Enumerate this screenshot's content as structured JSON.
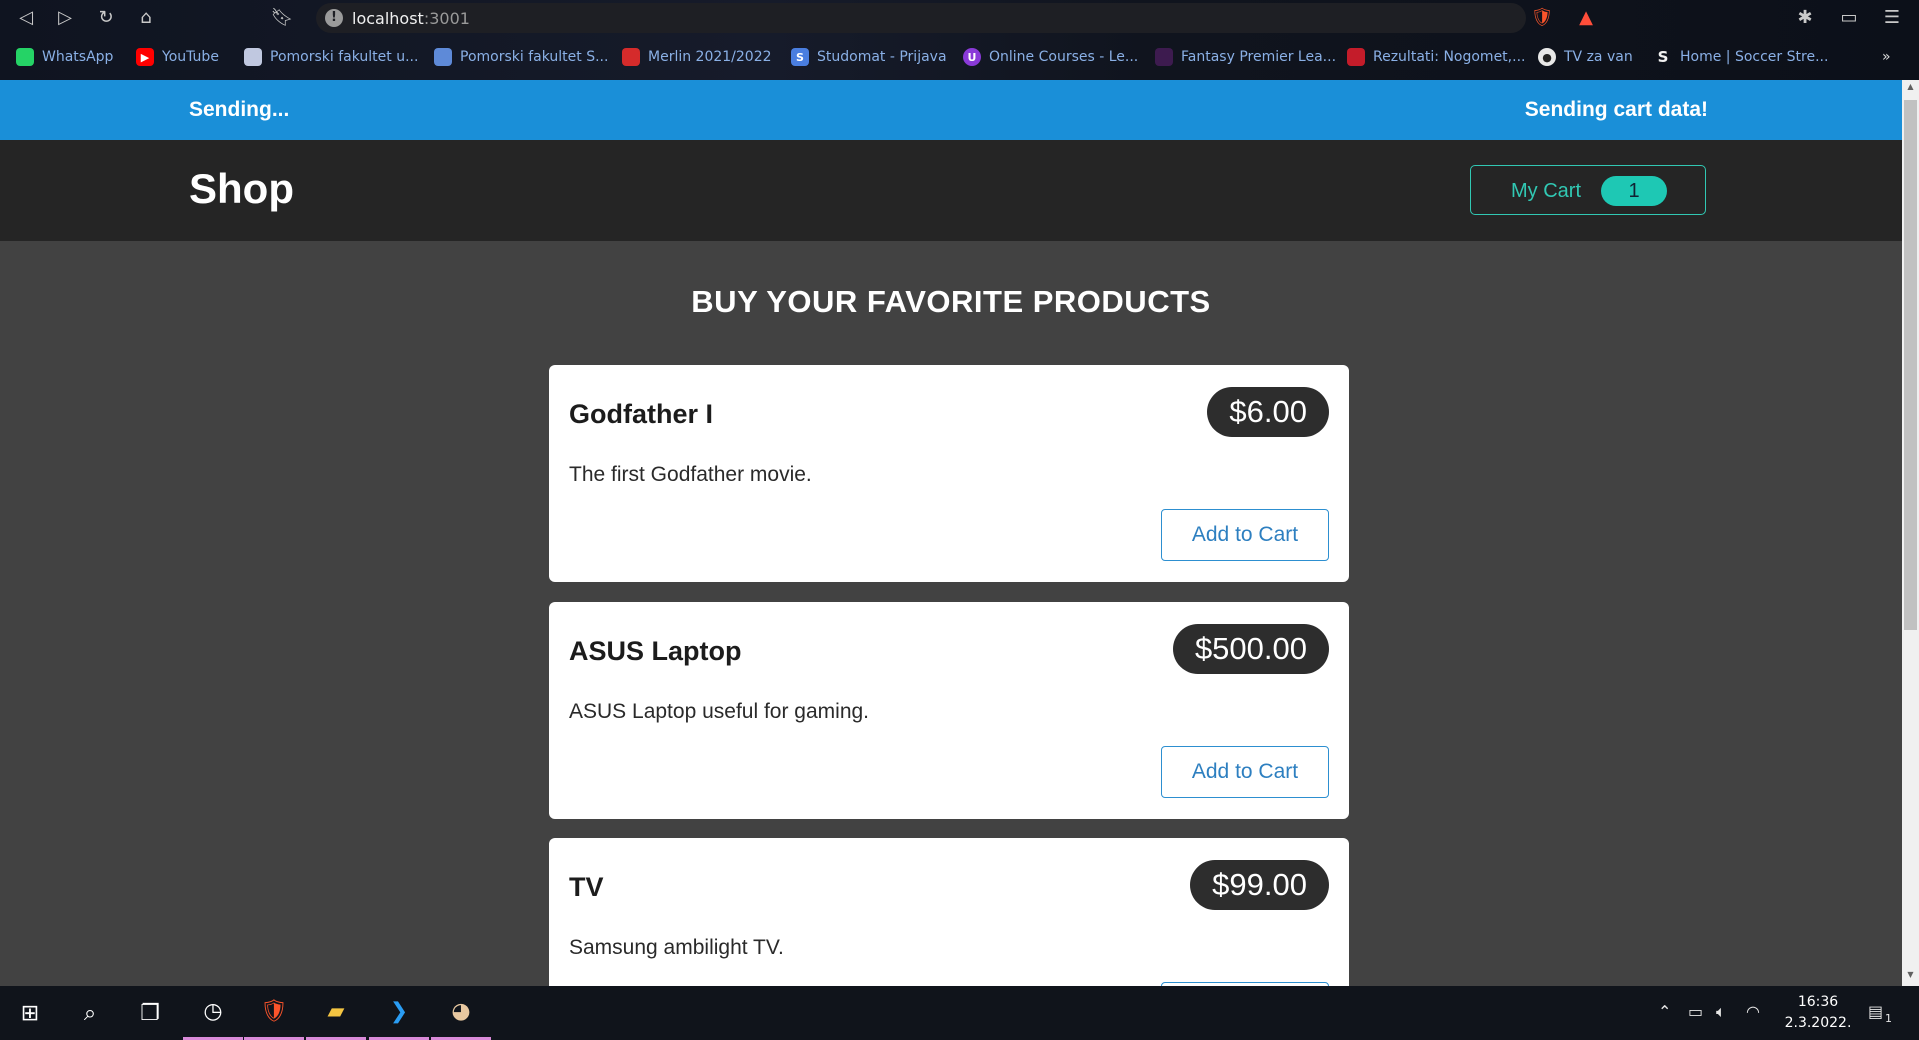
{
  "browser": {
    "url_host": "localhost",
    "url_port": ":3001",
    "bookmarks": [
      {
        "label": "WhatsApp",
        "icon": "whatsapp-icon",
        "color": "#25d366"
      },
      {
        "label": "YouTube",
        "icon": "youtube-icon",
        "color": "#ff0000"
      },
      {
        "label": "Pomorski fakultet u...",
        "icon": "pomorski-icon",
        "color": "#c0c8e0"
      },
      {
        "label": "Pomorski fakultet S...",
        "icon": "pomorski-s-icon",
        "color": "#5e8ad8"
      },
      {
        "label": "Merlin 2021/2022",
        "icon": "merlin-icon",
        "color": "#d52b2b"
      },
      {
        "label": "Studomat - Prijava",
        "icon": "studomat-icon",
        "color": "#4a7ee0"
      },
      {
        "label": "Online Courses - Le...",
        "icon": "udemy-icon",
        "color": "#8a3ad8"
      },
      {
        "label": "Fantasy Premier Lea...",
        "icon": "premier-league-icon",
        "color": "#3d1b4f"
      },
      {
        "label": "Rezultati: Nogomet,...",
        "icon": "rezultati-icon",
        "color": "#c41c2a"
      },
      {
        "label": "TV za van",
        "icon": "tv-globe-icon",
        "color": "#e8e8e8"
      },
      {
        "label": "Home | Soccer Stre...",
        "icon": "soccer-stream-icon",
        "color": "#f2f2f2"
      }
    ]
  },
  "app": {
    "notification_title": "Sending...",
    "notification_message": "Sending cart data!",
    "shop_title": "Shop",
    "cart_label": "My Cart",
    "cart_count": "1",
    "heading": "BUY YOUR FAVORITE PRODUCTS",
    "add_to_cart_label": "Add to Cart",
    "products": [
      {
        "name": "Godfather I",
        "price": "$6.00",
        "description": "The first Godfather movie."
      },
      {
        "name": "ASUS Laptop",
        "price": "$500.00",
        "description": "ASUS Laptop useful for gaming."
      },
      {
        "name": "TV",
        "price": "$99.00",
        "description": "Samsung ambilight TV."
      }
    ]
  },
  "colors": {
    "notification_bar": "#1a8fd8",
    "header": "#252525",
    "page_background": "#424242",
    "cart_accent": "#31c8b3",
    "price_badge": "#2d2d2d",
    "add_button": "#2d8fd0"
  },
  "taskbar": {
    "time": "16:36",
    "date": "2.3.2022.",
    "notification_count": "1"
  }
}
